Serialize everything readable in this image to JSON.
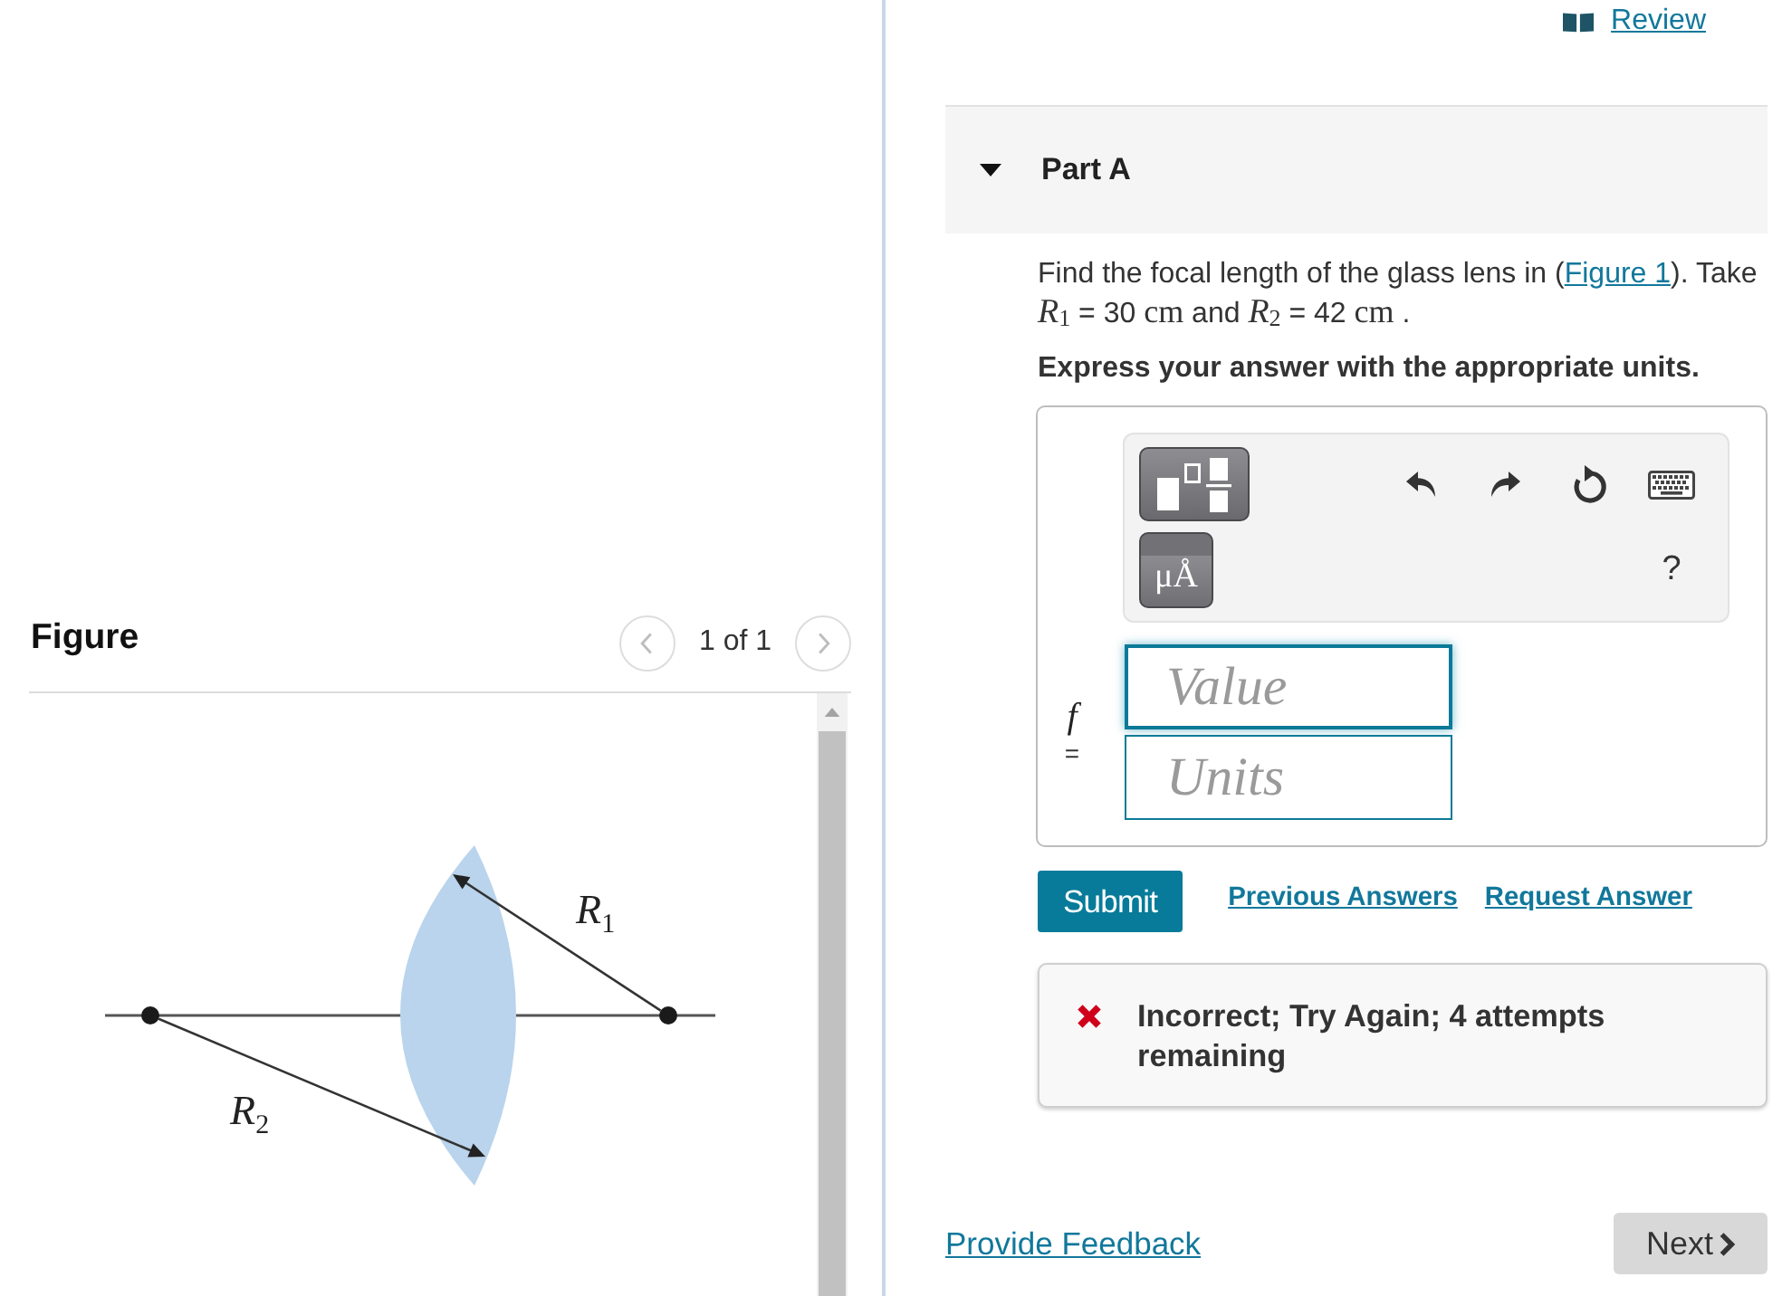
{
  "header": {
    "review_link": "Review"
  },
  "figure_panel": {
    "title": "Figure",
    "pager": {
      "text": "1 of 1",
      "prev": {
        "disabled": true
      },
      "next": {
        "disabled": true
      }
    },
    "labels": [
      {
        "symbol": "R",
        "subscript": "1"
      },
      {
        "symbol": "R",
        "subscript": "2"
      }
    ]
  },
  "part": {
    "title": "Part A",
    "expanded": true
  },
  "question": {
    "segments": [
      {
        "kind": "text",
        "text": "Find the focal length of the glass lens in ("
      },
      {
        "kind": "link",
        "text": "Figure 1"
      },
      {
        "kind": "text",
        "text": "). Take "
      },
      {
        "kind": "var",
        "symbol": "R",
        "subscript": "1"
      },
      {
        "kind": "text",
        "text": " = 30 "
      },
      {
        "kind": "unit",
        "text": "cm"
      },
      {
        "kind": "text",
        "text": " and "
      },
      {
        "kind": "var",
        "symbol": "R",
        "subscript": "2"
      },
      {
        "kind": "text",
        "text": " = 42 "
      },
      {
        "kind": "unit",
        "text": "cm"
      },
      {
        "kind": "text",
        "text": " ."
      }
    ]
  },
  "instruction": "Express your answer with the appropriate units.",
  "answer": {
    "toolbar": {
      "units_button": "μÅ",
      "help": "?"
    },
    "variable": "f",
    "equals": "=",
    "fields": [
      {
        "placeholder": "Value",
        "focused": true
      },
      {
        "placeholder": "Units",
        "focused": false
      }
    ]
  },
  "actions": {
    "submit": "Submit",
    "links": [
      "Previous Answers",
      "Request Answer"
    ]
  },
  "feedback": {
    "kind": "incorrect",
    "message": "Incorrect; Try Again; 4 attempts remaining"
  },
  "footer": {
    "feedback_link": "Provide Feedback",
    "next_button": "Next"
  }
}
